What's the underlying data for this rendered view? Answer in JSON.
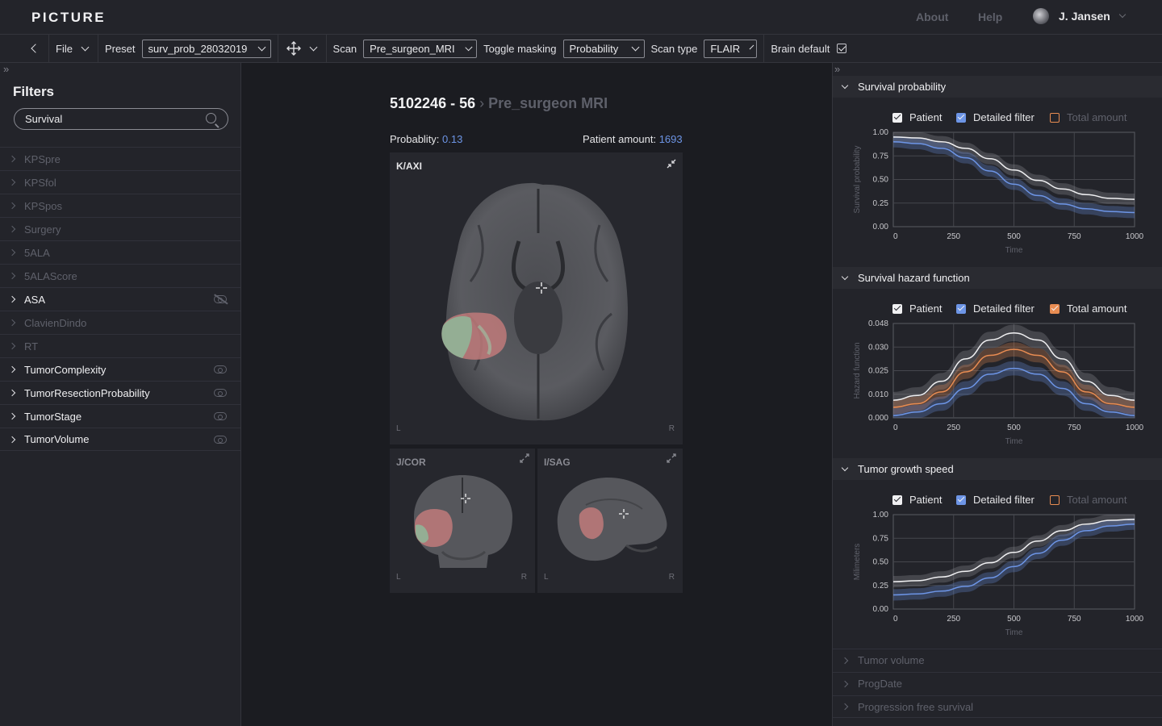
{
  "app": {
    "logo": "PICTURE",
    "nav": [
      "About",
      "Help"
    ],
    "user": "J. Jansen"
  },
  "toolbar": {
    "file_label": "File",
    "preset_label": "Preset",
    "preset_value": "surv_prob_28032019",
    "scan_label": "Scan",
    "scan_value": "Pre_surgeon_MRI",
    "masking_label": "Toggle masking",
    "masking_value": "Probability",
    "scantype_label": "Scan type",
    "scantype_value": "FLAIR",
    "brain_label": "Brain default",
    "brain_checked": true
  },
  "filters": {
    "title": "Filters",
    "search_value": "Survival",
    "items": [
      {
        "label": "KPSpre",
        "active": false,
        "eye": ""
      },
      {
        "label": "KPSfol",
        "active": false,
        "eye": ""
      },
      {
        "label": "KPSpos",
        "active": false,
        "eye": ""
      },
      {
        "label": "Surgery",
        "active": false,
        "eye": ""
      },
      {
        "label": "5ALA",
        "active": false,
        "eye": ""
      },
      {
        "label": "5ALAScore",
        "active": false,
        "eye": ""
      },
      {
        "label": "ASA",
        "active": true,
        "eye": "eye-off-icon"
      },
      {
        "label": "ClavienDindo",
        "active": false,
        "eye": ""
      },
      {
        "label": "RT",
        "active": false,
        "eye": ""
      },
      {
        "label": "TumorComplexity",
        "active": true,
        "eye": "eye-icon"
      },
      {
        "label": "TumorResectionProbability",
        "active": true,
        "eye": "eye-icon"
      },
      {
        "label": "TumorStage",
        "active": true,
        "eye": "eye-icon"
      },
      {
        "label": "TumorVolume",
        "active": true,
        "eye": "eye-icon"
      }
    ]
  },
  "case": {
    "id": "5102246 - 56",
    "scan": "Pre_surgeon MRI",
    "prob_label": "Probablity:",
    "prob_value": "0.13",
    "amount_label": "Patient amount:",
    "amount_value": "1693"
  },
  "viewers": {
    "axial": {
      "label": "K/AXI",
      "left": "L",
      "right": "R"
    },
    "coronal": {
      "label": "J/COR",
      "left": "L",
      "right": "R"
    },
    "sagittal": {
      "label": "I/SAG",
      "left": "L",
      "right": "R"
    }
  },
  "colors": {
    "accent": "#6d95e6",
    "orange": "#e88c52",
    "white_line": "#f0f0f2"
  },
  "legend": {
    "patient": "Patient",
    "detailed": "Detailed filter",
    "total": "Total amount"
  },
  "sections": {
    "survival": "Survival probability",
    "hazard": "Survival hazard function",
    "growth": "Tumor growth speed",
    "collapsed": [
      "Tumor volume",
      "ProgDate",
      "Progression free survival"
    ]
  },
  "chart_data": [
    {
      "type": "line",
      "title": "Survival probability",
      "xlabel": "Time",
      "ylabel": "Survival probability",
      "xlim": [
        0,
        1000
      ],
      "ylim": [
        0,
        1
      ],
      "x_ticks": [
        0,
        250,
        500,
        750,
        1000
      ],
      "y_tick_labels": [
        "1.00",
        "0.75",
        "0.50",
        "0.25",
        "0.00"
      ],
      "y_tick_values": [
        1.0,
        0.75,
        0.5,
        0.25,
        0.0
      ],
      "total_enabled": false,
      "x": [
        0,
        100,
        200,
        300,
        400,
        500,
        600,
        700,
        800,
        900,
        1000
      ],
      "series": [
        {
          "name": "Patient",
          "color": "#f0f0f2",
          "values": [
            0.95,
            0.94,
            0.9,
            0.83,
            0.72,
            0.6,
            0.49,
            0.4,
            0.34,
            0.3,
            0.29
          ],
          "band": 0.06
        },
        {
          "name": "Detailed filter",
          "color": "#6d95e6",
          "values": [
            0.9,
            0.88,
            0.83,
            0.73,
            0.59,
            0.45,
            0.33,
            0.24,
            0.19,
            0.16,
            0.15
          ],
          "band": 0.06
        }
      ]
    },
    {
      "type": "line",
      "title": "Survival hazard function",
      "xlabel": "Time",
      "ylabel": "Hazard function",
      "xlim": [
        0,
        1000
      ],
      "ylim": [
        0,
        4
      ],
      "x_ticks": [
        0,
        250,
        500,
        750,
        1000
      ],
      "y_tick_labels": [
        "0.048",
        "0.030",
        "0.025",
        "0.010",
        "0.000"
      ],
      "y_tick_values": [
        4,
        3,
        2,
        1,
        0
      ],
      "total_enabled": true,
      "x": [
        0,
        100,
        200,
        300,
        400,
        500,
        600,
        700,
        800,
        900,
        1000
      ],
      "series": [
        {
          "name": "Patient",
          "color": "#f0f0f2",
          "values": [
            0.75,
            0.95,
            1.55,
            2.5,
            3.3,
            3.6,
            3.3,
            2.5,
            1.55,
            0.95,
            0.75
          ],
          "band": 0.35
        },
        {
          "name": "Total amount",
          "color": "#e88c52",
          "values": [
            0.45,
            0.6,
            1.1,
            1.95,
            2.65,
            2.9,
            2.65,
            1.95,
            1.1,
            0.6,
            0.45
          ],
          "band": 0.3
        },
        {
          "name": "Detailed filter",
          "color": "#6d95e6",
          "values": [
            0.1,
            0.25,
            0.6,
            1.25,
            1.85,
            2.1,
            1.85,
            1.25,
            0.6,
            0.25,
            0.1
          ],
          "band": 0.3
        }
      ]
    },
    {
      "type": "line",
      "title": "Tumor growth speed",
      "xlabel": "Time",
      "ylabel": "Milimeters",
      "xlim": [
        0,
        1000
      ],
      "ylim": [
        0,
        1
      ],
      "x_ticks": [
        0,
        250,
        500,
        750,
        1000
      ],
      "y_tick_labels": [
        "1.00",
        "0.75",
        "0.50",
        "0.25",
        "0.00"
      ],
      "y_tick_values": [
        1.0,
        0.75,
        0.5,
        0.25,
        0.0
      ],
      "total_enabled": false,
      "x": [
        0,
        100,
        200,
        300,
        400,
        500,
        600,
        700,
        800,
        900,
        1000
      ],
      "series": [
        {
          "name": "Patient",
          "color": "#f0f0f2",
          "values": [
            0.29,
            0.3,
            0.34,
            0.4,
            0.49,
            0.6,
            0.72,
            0.83,
            0.9,
            0.94,
            0.95
          ],
          "band": 0.06
        },
        {
          "name": "Detailed filter",
          "color": "#6d95e6",
          "values": [
            0.15,
            0.16,
            0.19,
            0.24,
            0.33,
            0.45,
            0.59,
            0.73,
            0.83,
            0.88,
            0.9
          ],
          "band": 0.06
        }
      ]
    }
  ]
}
